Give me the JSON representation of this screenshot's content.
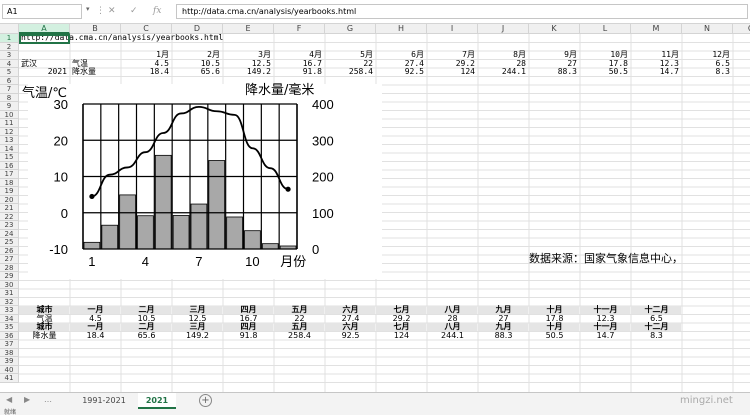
{
  "formula_bar": {
    "name_box": "A1",
    "formula": "http://data.cma.cn/analysis/yearbooks.html",
    "icons": [
      "cancel-icon",
      "enter-icon",
      "function-icon"
    ]
  },
  "columns": [
    "A",
    "B",
    "C",
    "D",
    "E",
    "F",
    "G",
    "H",
    "I",
    "J",
    "K",
    "L",
    "M",
    "N",
    "O"
  ],
  "rows": [
    "1",
    "2",
    "3",
    "4",
    "5",
    "6",
    "7",
    "8",
    "9",
    "10",
    "11",
    "12",
    "13",
    "14",
    "15",
    "16",
    "17",
    "18",
    "19",
    "20",
    "21",
    "22",
    "23",
    "24",
    "25",
    "26",
    "27",
    "28",
    "29",
    "30",
    "31",
    "32",
    "33",
    "34",
    "35",
    "36",
    "37",
    "38",
    "39",
    "40",
    "41"
  ],
  "sheet": {
    "url_cell": "http://data.cma.cn/analysis/yearbooks.html",
    "month_labels": [
      "1月",
      "2月",
      "3月",
      "4月",
      "5月",
      "6月",
      "7月",
      "8月",
      "9月",
      "10月",
      "11月",
      "12月"
    ],
    "city": "武汉",
    "year": "2021",
    "temp_label": "气温",
    "precip_label": "降水量",
    "temp_values": [
      "4.5",
      "10.5",
      "12.5",
      "16.7",
      "22",
      "27.4",
      "29.2",
      "28",
      "27",
      "17.8",
      "12.3",
      "6.5"
    ],
    "precip_values": [
      "18.4",
      "65.6",
      "149.2",
      "91.8",
      "258.4",
      "92.5",
      "124",
      "244.1",
      "88.3",
      "50.5",
      "14.7",
      "8.3"
    ],
    "source_note": "数据来源：国家气象信息中心，",
    "table": {
      "city_header": "城市",
      "month_headers": [
        "一月",
        "二月",
        "三月",
        "四月",
        "五月",
        "六月",
        "七月",
        "八月",
        "九月",
        "十月",
        "十一月",
        "十二月"
      ],
      "temp_label": "气温",
      "precip_label": "降水量",
      "temp_values": [
        "4.5",
        "10.5",
        "12.5",
        "16.7",
        "22",
        "27.4",
        "29.2",
        "28",
        "27",
        "17.8",
        "12.3",
        "6.5"
      ],
      "precip_values": [
        "18.4",
        "65.6",
        "149.2",
        "91.8",
        "258.4",
        "92.5",
        "124",
        "244.1",
        "88.3",
        "50.5",
        "14.7",
        "8.3"
      ]
    }
  },
  "chart_data": {
    "type": "bar",
    "x": [
      1,
      2,
      3,
      4,
      5,
      6,
      7,
      8,
      9,
      10,
      11,
      12
    ],
    "x_tick_labels": [
      "1",
      "4",
      "7",
      "10"
    ],
    "x_unit_label": "月份",
    "left_axis_title": "气温/℃",
    "right_axis_title": "降水量/毫米",
    "left_ticks": [
      "30",
      "20",
      "10",
      "0",
      "-10"
    ],
    "right_ticks": [
      "400",
      "300",
      "200",
      "100",
      "0"
    ],
    "left_ylim": [
      -10,
      30
    ],
    "right_ylim": [
      0,
      400
    ],
    "series": [
      {
        "name": "降水量",
        "kind": "bar",
        "axis": "right",
        "values": [
          18.4,
          65.6,
          149.2,
          91.8,
          258.4,
          92.5,
          124,
          244.1,
          88.3,
          50.5,
          14.7,
          8.3
        ]
      },
      {
        "name": "气温",
        "kind": "line",
        "axis": "left",
        "values": [
          4.5,
          10.5,
          12.5,
          16.7,
          22,
          27.4,
          29.2,
          28,
          27,
          17.8,
          12.3,
          6.5
        ]
      }
    ],
    "bar_color": "#a8a8a8",
    "line_color": "#000000",
    "grid": true
  },
  "tabs": [
    {
      "label": "1991-2021",
      "active": false
    },
    {
      "label": "2021",
      "active": true
    }
  ],
  "add_sheet_label": "+",
  "status_text": "就绪",
  "watermark": "mingzi.net"
}
